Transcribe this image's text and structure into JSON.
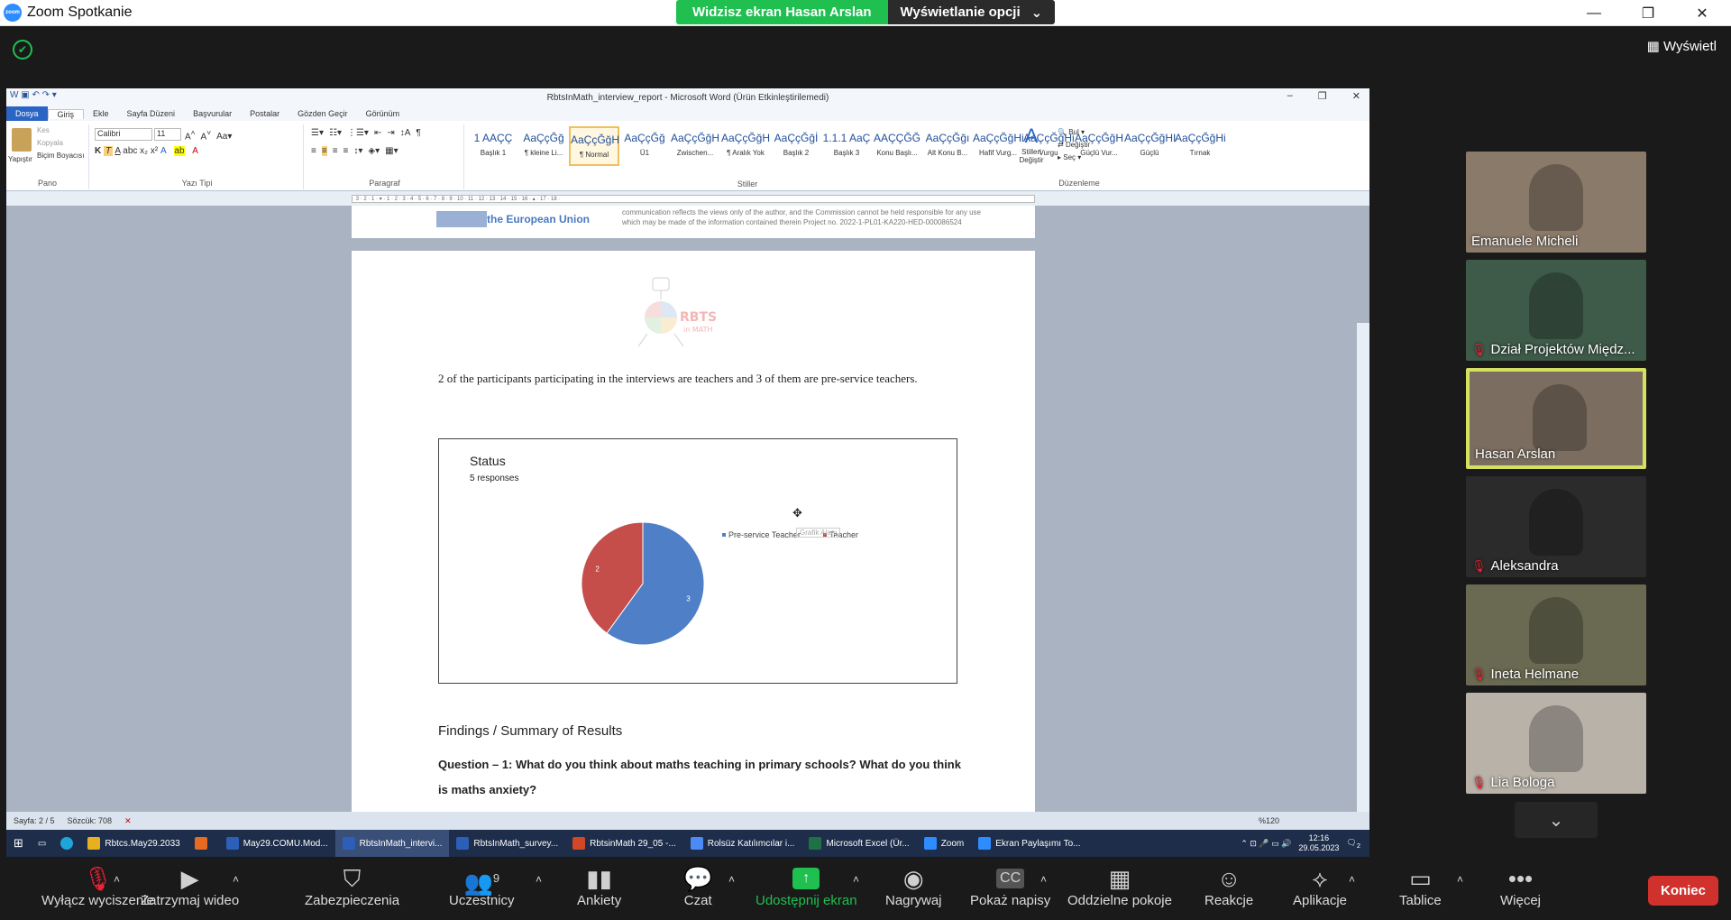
{
  "zoom": {
    "app_title": "Zoom Spotkanie",
    "logo_text": "zoom",
    "share_banner": "Widzisz ekran Hasan Arslan",
    "view_options": "Wyświetlanie opcji",
    "view_button": "Wyświetl"
  },
  "word": {
    "window_title": "RbtsInMath_interview_report - Microsoft Word (Ürün Etkinleştirilemedi)",
    "tabs": [
      "Dosya",
      "Giriş",
      "Ekle",
      "Sayfa Düzeni",
      "Başvurular",
      "Postalar",
      "Gözden Geçir",
      "Görünüm"
    ],
    "clipboard": {
      "paste": "Yapıştır",
      "cut": "Kes",
      "copy": "Kopyala",
      "format_painter": "Biçim Boyacısı",
      "group": "Pano"
    },
    "font": {
      "name": "Calibri",
      "size": "11",
      "group": "Yazı Tipi"
    },
    "paragraph_group": "Paragraf",
    "styles": [
      {
        "sample": "1 AAÇÇ",
        "name": "Başlık 1"
      },
      {
        "sample": "AaÇçĞğ",
        "name": "¶ kleine Li..."
      },
      {
        "sample": "AaÇçĞğH",
        "name": "¶ Normal"
      },
      {
        "sample": "AaÇçĞğ",
        "name": "Ü1"
      },
      {
        "sample": "AaÇçĞğH",
        "name": "Zwischen..."
      },
      {
        "sample": "AaÇçĞğH",
        "name": "¶ Aralık Yok"
      },
      {
        "sample": "AaÇçĞğİ",
        "name": "Başlık 2"
      },
      {
        "sample": "1.1.1 AaÇ",
        "name": "Başlık 3"
      },
      {
        "sample": "AAÇÇĞĞ",
        "name": "Konu Başlı..."
      },
      {
        "sample": "AaÇçĞğı",
        "name": "Alt Konu B..."
      },
      {
        "sample": "AaÇçĞğHi",
        "name": "Hafif Vurg..."
      },
      {
        "sample": "AaÇçĞğHi",
        "name": "Vurgu"
      },
      {
        "sample": "AaÇçĞğH",
        "name": "Güçlü Vur..."
      },
      {
        "sample": "AaÇçĞğHI",
        "name": "Güçlü"
      },
      {
        "sample": "AaÇçĞğHi",
        "name": "Tırnak"
      }
    ],
    "styles_group": "Stiller",
    "change_styles": "Stilleri Değiştir",
    "editing": {
      "find": "Bul",
      "replace": "Değiştir",
      "select": "Seç",
      "group": "Düzenleme"
    },
    "doc": {
      "eu_text": "the European Union",
      "disclaimer": "communication reflects the views only of the author, and the Commission cannot be held responsible for any use which may be made of the information contained therein Project no. 2022-1-PL01-KA220-HED-000086524",
      "logo_text": "RBTS",
      "logo_sub": "in MATH",
      "paragraph": "2 of the participants participating in the interviews are teachers and 3 of them are pre-service teachers.",
      "chart_tooltip": "Grafik Alanı",
      "findings_heading": "Findings / Summary of Results",
      "question": "Question – 1: What do you think about maths teaching in primary schools? What do you think is maths anxiety?"
    },
    "status": {
      "page": "Sayfa: 2 / 5",
      "words": "Sözcük: 708",
      "zoom": "%120"
    }
  },
  "chart_data": {
    "type": "pie",
    "title": "Status",
    "subtitle": "5 responses",
    "categories": [
      "Pre-service Teacher",
      "Teacher"
    ],
    "values": [
      3,
      2
    ],
    "colors": [
      "#4f7fc6",
      "#c54e4a"
    ],
    "legend_position": "right"
  },
  "taskbar": {
    "items": [
      {
        "label": "Rbtcs.May29.2033",
        "color": "#e8b020"
      },
      {
        "label": "",
        "color": "#e66a1f"
      },
      {
        "label": "May29.COMU.Mod...",
        "color": "#2b5fb8"
      },
      {
        "label": "RbtsInMath_intervi...",
        "color": "#2b5fb8"
      },
      {
        "label": "RbtsInMath_survey...",
        "color": "#2b5fb8"
      },
      {
        "label": "RbtsinMath 29_05 -...",
        "color": "#d24726"
      },
      {
        "label": "Rolsüz Katılımcılar i...",
        "color": "#4c8bf5"
      },
      {
        "label": "Microsoft Excel (Ür...",
        "color": "#1e7145"
      },
      {
        "label": "Zoom",
        "color": "#2d8cff"
      },
      {
        "label": "Ekran Paylaşımı To...",
        "color": "#2d8cff"
      }
    ],
    "time": "12:16",
    "date": "29.05.2023",
    "notifications": "2"
  },
  "participants": [
    {
      "name": "Emanuele Micheli",
      "muted": false,
      "bg": "#8a7a6a"
    },
    {
      "name": "Dział Projektów Międz...",
      "muted": true,
      "bg": "#3e5a48"
    },
    {
      "name": "Hasan Arslan",
      "muted": false,
      "bg": "#7b6e60"
    },
    {
      "name": "Aleksandra",
      "muted": true,
      "bg": "#2b2b2b"
    },
    {
      "name": "Ineta Helmane",
      "muted": true,
      "bg": "#6a6a52"
    },
    {
      "name": "Lia Bologa",
      "muted": true,
      "bg": "#b8b2a8"
    }
  ],
  "toolbar": {
    "mute": "Wyłącz wyciszenie",
    "video": "Zatrzymaj wideo",
    "security": "Zabezpieczenia",
    "participants": "Uczestnicy",
    "participants_count": "9",
    "polls": "Ankiety",
    "chat": "Czat",
    "share": "Udostępnij ekran",
    "record": "Nagrywaj",
    "captions": "Pokaż napisy",
    "breakout": "Oddzielne pokoje",
    "reactions": "Reakcje",
    "apps": "Aplikacje",
    "whiteboards": "Tablice",
    "more": "Więcej",
    "end": "Koniec"
  }
}
